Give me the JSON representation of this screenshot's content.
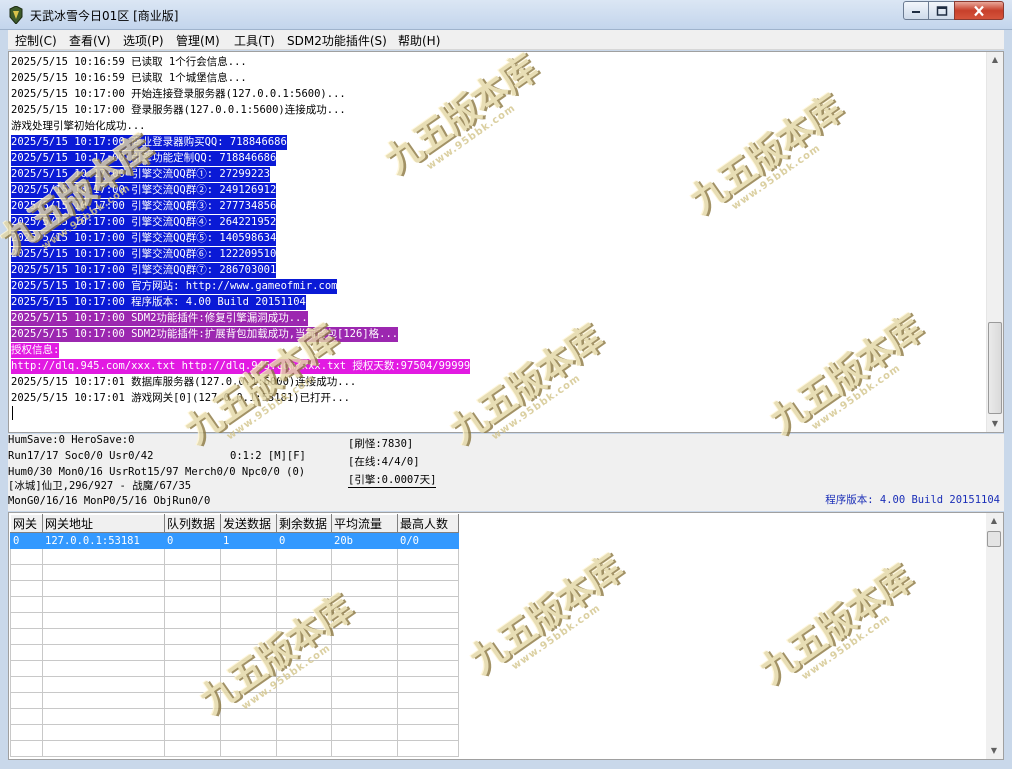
{
  "window": {
    "title": "天武冰雪今日01区 [商业版]"
  },
  "menu": [
    {
      "label": "控制(C)"
    },
    {
      "label": "查看(V)"
    },
    {
      "label": "选项(P)"
    },
    {
      "label": "管理(M)"
    },
    {
      "label": "工具(T)"
    },
    {
      "label": "SDM2功能插件(S)"
    },
    {
      "label": "帮助(H)"
    }
  ],
  "log": [
    {
      "text": "2025/5/15 10:16:59 已读取 1个行会信息...",
      "style": "normal"
    },
    {
      "text": "2025/5/15 10:16:59 已读取 1个城堡信息...",
      "style": "normal"
    },
    {
      "text": "2025/5/15 10:17:00 开始连接登录服务器(127.0.0.1:5600)...",
      "style": "normal"
    },
    {
      "text": "2025/5/15 10:17:00 登录服务器(127.0.0.1:5600)连接成功...",
      "style": "normal"
    },
    {
      "text": "游戏处理引擎初始化成功...",
      "style": "normal"
    },
    {
      "text": "2025/5/15 10:17:00 商业登录器购买QQ: 718846686",
      "style": "blue"
    },
    {
      "text": "2025/5/15 10:17:00 引擎功能定制QQ: 718846686",
      "style": "blue"
    },
    {
      "text": "2025/5/15 10:17:00 引擎交流QQ群①: 27299223",
      "style": "blue"
    },
    {
      "text": "2025/5/15 10:17:00 引擎交流QQ群②: 249126912",
      "style": "blue"
    },
    {
      "text": "2025/5/15 10:17:00 引擎交流QQ群③: 277734856",
      "style": "blue"
    },
    {
      "text": "2025/5/15 10:17:00 引擎交流QQ群④: 264221952",
      "style": "blue"
    },
    {
      "text": "2025/5/15 10:17:00 引擎交流QQ群⑤: 140598634",
      "style": "blue"
    },
    {
      "text": "2025/5/15 10:17:00 引擎交流QQ群⑥: 122209510",
      "style": "blue"
    },
    {
      "text": "2025/5/15 10:17:00 引擎交流QQ群⑦: 286703001",
      "style": "blue"
    },
    {
      "text": "2025/5/15 10:17:00 官方网站: http://www.gameofmir.com",
      "style": "blue"
    },
    {
      "text": "2025/5/15 10:17:00 程序版本: 4.00 Build 20151104",
      "style": "blue"
    },
    {
      "text": "2025/5/15 10:17:00 SDM2功能插件:修复引擎漏洞成功...",
      "style": "purple"
    },
    {
      "text": "2025/5/15 10:17:00 SDM2功能插件:扩展背包加载成功,当前背包[126]格...",
      "style": "purple"
    },
    {
      "text": "授权信息:",
      "style": "magenta"
    },
    {
      "text": "http://dlq.945.com/xxx.txt http://dlq.945.com/xxx.txt 授权天数:97504/99999",
      "style": "magenta"
    },
    {
      "text": "2025/5/15 10:17:01 数据库服务器(127.0.0.1:6000)连接成功...",
      "style": "normal"
    },
    {
      "text": "2025/5/15 10:17:01 游戏网关[0](127.0.0.1:53181)已打开...",
      "style": "normal"
    }
  ],
  "status": {
    "hum_save": "HumSave:0 HeroSave:0",
    "run": "Run17/17 Soc0/0 Usr0/42",
    "ratio": "0:1:2 [M][F]",
    "hum": "Hum0/30 Mon0/16 UsrRot15/97 Merch0/0 Npc0/0 (0)",
    "location": "[冰城]仙卫,296/927 - 战魔/67/35",
    "mon": "MonG0/16/16 MonP0/5/16 ObjRun0/0",
    "refresh": "[刷怪:7830]",
    "online": "[在线:4/4/0]",
    "engine": "[引擎:0.0007天]",
    "version": "程序版本: 4.00 Build 20151104"
  },
  "gateway_table": {
    "columns": [
      "网关",
      "网关地址",
      "队列数据",
      "发送数据",
      "剩余数据",
      "平均流量",
      "最高人数"
    ],
    "rows": [
      [
        "0",
        "127.0.0.1:53181",
        "0",
        "1",
        "0",
        "20b",
        "0/0"
      ]
    ]
  },
  "watermark": {
    "text": "九五版本库",
    "url": "www.95bbk.com"
  },
  "colors": {
    "log_blue": "#0a1ad6",
    "log_purple": "#9c27b0",
    "log_magenta": "#e21ae2",
    "selection": "#3399ff",
    "version_text": "#1b2fb8"
  }
}
